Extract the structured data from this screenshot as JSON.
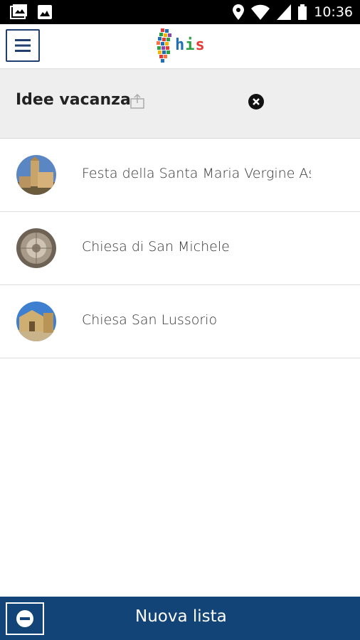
{
  "status_bar": {
    "time": "10:36",
    "icons": [
      "gallery-notification-icon",
      "image-notification-icon",
      "location-icon",
      "wifi-icon",
      "signal-icon",
      "battery-icon"
    ]
  },
  "header": {
    "menu_icon": "hamburger-menu-icon",
    "logo_text": "his",
    "logo_colors": [
      "#1f6fb2",
      "#2e9e44",
      "#e53935",
      "#f4b400",
      "#8e44ad",
      "#ff7043"
    ]
  },
  "list": {
    "title": "Idee vacanza",
    "share_icon": "share-icon",
    "close_icon": "close-circle-icon"
  },
  "items": [
    {
      "label": "Festa della Santa Maria Vergine As",
      "thumb": "church-tower-photo"
    },
    {
      "label": "Chiesa di San Michele",
      "thumb": "church-dome-interior-photo"
    },
    {
      "label": "Chiesa San Lussorio",
      "thumb": "stone-church-photo"
    }
  ],
  "footer": {
    "minus_icon": "remove-circle-icon",
    "new_list_label": "Nuova lista",
    "bar_color": "#124478"
  }
}
